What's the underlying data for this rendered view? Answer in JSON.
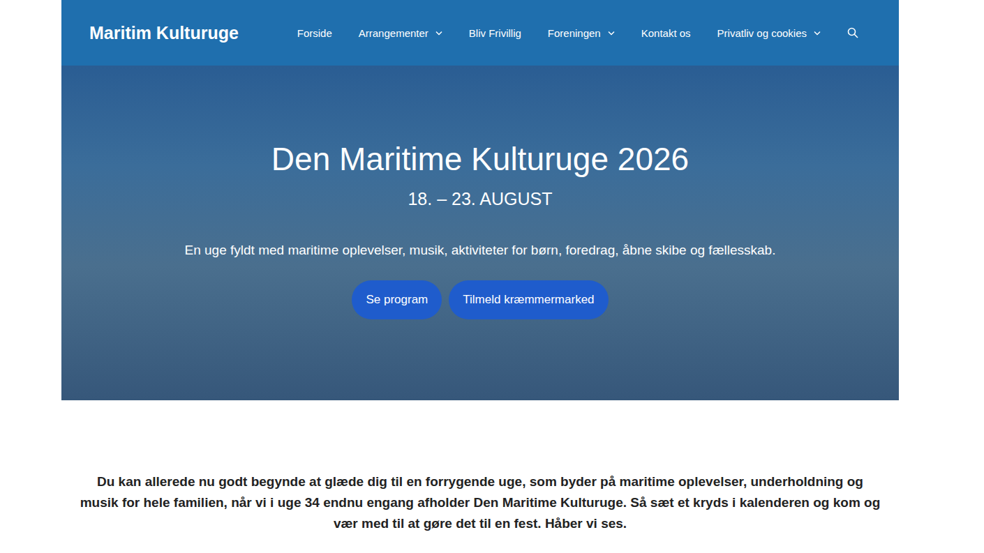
{
  "header": {
    "logo": "Maritim Kulturuge",
    "nav": [
      {
        "label": "Forside",
        "has_submenu": false
      },
      {
        "label": "Arrangementer",
        "has_submenu": true
      },
      {
        "label": "Bliv Frivillig",
        "has_submenu": false
      },
      {
        "label": "Foreningen",
        "has_submenu": true
      },
      {
        "label": "Kontakt os",
        "has_submenu": false
      },
      {
        "label": "Privatliv og cookies",
        "has_submenu": true
      }
    ]
  },
  "hero": {
    "title": "Den Maritime Kulturuge 2026",
    "date": "18. – 23. AUGUST",
    "tagline": "En uge fyldt med maritime oplevelser, musik, aktiviteter for børn, foredrag, åbne skibe og fællesskab.",
    "buttons": [
      "Se program",
      "Tilmeld kræmmermarked"
    ]
  },
  "intro": "Du kan allerede nu godt begynde at glæde dig til en forrygende uge, som byder på maritime oplevelser, underholdning og musik for hele familien, når vi i uge 34 endnu engang afholder Den Maritime Kulturuge. Så sæt et kryds i kalenderen og kom og vær med til at gøre det til en fest. Håber vi ses."
}
